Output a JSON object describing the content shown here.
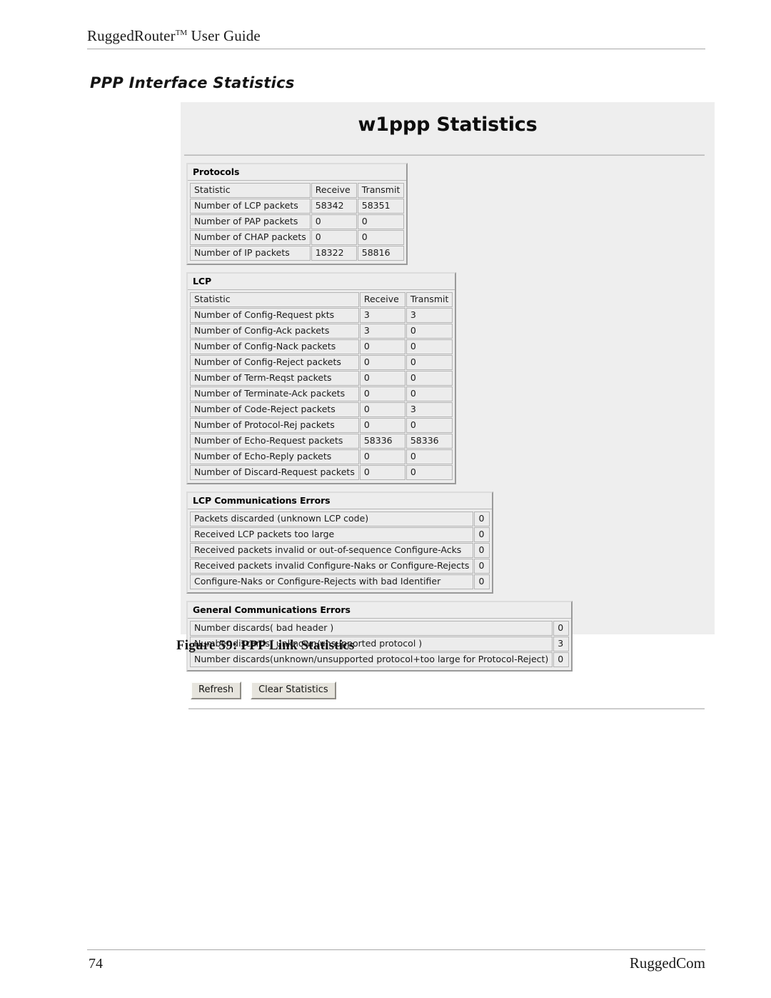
{
  "page": {
    "running_head_main": "RuggedRouter",
    "running_head_tm": "TM",
    "running_head_rest": " User Guide",
    "section_title": "PPP Interface Statistics",
    "figure_caption": "Figure 59: PPP Link Statistics",
    "footer_page_number": "74",
    "footer_company": "RuggedCom"
  },
  "screenshot": {
    "title": "w1ppp Statistics",
    "protocols": {
      "legend": "Protocols",
      "columns": [
        "Statistic",
        "Receive",
        "Transmit"
      ],
      "rows": [
        {
          "label": "Number of LCP packets",
          "receive": "58342",
          "transmit": "58351"
        },
        {
          "label": "Number of PAP packets",
          "receive": "0",
          "transmit": "0"
        },
        {
          "label": "Number of CHAP packets",
          "receive": "0",
          "transmit": "0"
        },
        {
          "label": "Number of IP packets",
          "receive": "18322",
          "transmit": "58816"
        }
      ]
    },
    "lcp": {
      "legend": "LCP",
      "columns": [
        "Statistic",
        "Receive",
        "Transmit"
      ],
      "rows": [
        {
          "label": "Number of Config-Request pkts",
          "receive": "3",
          "transmit": "3"
        },
        {
          "label": "Number of Config-Ack packets",
          "receive": "3",
          "transmit": "0"
        },
        {
          "label": "Number of Config-Nack packets",
          "receive": "0",
          "transmit": "0"
        },
        {
          "label": "Number of Config-Reject packets",
          "receive": "0",
          "transmit": "0"
        },
        {
          "label": "Number of Term-Reqst packets",
          "receive": "0",
          "transmit": "0"
        },
        {
          "label": "Number of Terminate-Ack packets",
          "receive": "0",
          "transmit": "0"
        },
        {
          "label": "Number of Code-Reject packets",
          "receive": "0",
          "transmit": "3"
        },
        {
          "label": "Number of Protocol-Rej packets",
          "receive": "0",
          "transmit": "0"
        },
        {
          "label": "Number of Echo-Request packets",
          "receive": "58336",
          "transmit": "58336"
        },
        {
          "label": "Number of Echo-Reply packets",
          "receive": "0",
          "transmit": "0"
        },
        {
          "label": "Number of Discard-Request packets",
          "receive": "0",
          "transmit": "0"
        }
      ]
    },
    "lcp_errors": {
      "legend": "LCP Communications Errors",
      "rows": [
        {
          "label": "Packets discarded (unknown LCP code)",
          "value": "0"
        },
        {
          "label": "Received LCP packets too large",
          "value": "0"
        },
        {
          "label": "Received packets invalid or out-of-sequence Configure-Acks",
          "value": "0"
        },
        {
          "label": "Received packets invalid Configure-Naks or Configure-Rejects",
          "value": "0"
        },
        {
          "label": "Configure-Naks or Configure-Rejects with bad Identifier",
          "value": "0"
        }
      ]
    },
    "general_errors": {
      "legend": "General Communications Errors",
      "rows": [
        {
          "label": "Number discards( bad header )",
          "value": "0"
        },
        {
          "label": "Number discards( unknown/unsupported protocol )",
          "value": "3"
        },
        {
          "label": "Number discards(unknown/unsupported protocol+too large for Protocol-Reject)",
          "value": "0"
        }
      ]
    },
    "buttons": {
      "refresh": "Refresh",
      "clear_statistics": "Clear Statistics"
    }
  }
}
